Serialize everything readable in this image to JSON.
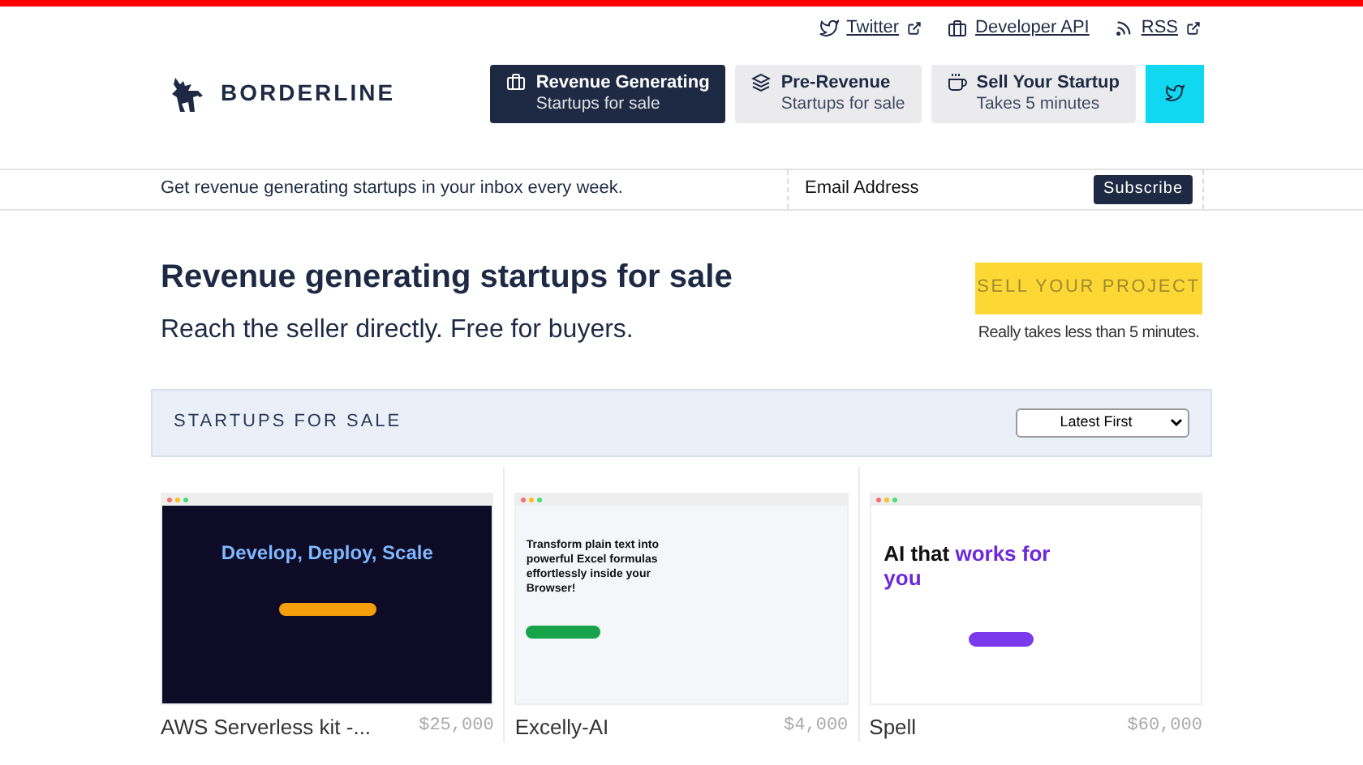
{
  "top_links": [
    {
      "kind": "twitter",
      "label": "Twitter",
      "external": true
    },
    {
      "kind": "api",
      "label": "Developer API",
      "external": false
    },
    {
      "kind": "rss",
      "label": "RSS",
      "external": true
    }
  ],
  "brand": "BORDERLINE",
  "nav": [
    {
      "title": "Revenue Generating",
      "subtitle": "Startups for sale",
      "selected": true
    },
    {
      "title": "Pre-Revenue",
      "subtitle": "Startups for sale",
      "selected": false
    },
    {
      "title": "Sell Your Startup",
      "subtitle": "Takes 5 minutes",
      "selected": false
    }
  ],
  "newsletter": {
    "text": "Get revenue generating startups in your inbox every week.",
    "placeholder": "Email Address",
    "button": "Subscribe"
  },
  "hero": {
    "title": "Revenue generating startups for sale",
    "subtitle": "Reach the seller directly. Free for buyers.",
    "cta": "SELL YOUR PROJECT",
    "cta_note": "Really takes less than 5 minutes."
  },
  "listing": {
    "heading": "STARTUPS FOR SALE",
    "sort": "Latest First"
  },
  "cards": [
    {
      "kind": "dark",
      "name": "AWS Serverless kit -...",
      "price": "$25,000",
      "shot_headline": "Develop, Deploy, Scale"
    },
    {
      "kind": "green",
      "name": "Excelly-AI",
      "price": "$4,000",
      "shot_headline": "Transform plain text into powerful Excel formulas effortlessly inside your Browser!"
    },
    {
      "kind": "light",
      "name": "Spell",
      "price": "$60,000",
      "shot_headline": "AI that **works for you**"
    }
  ]
}
